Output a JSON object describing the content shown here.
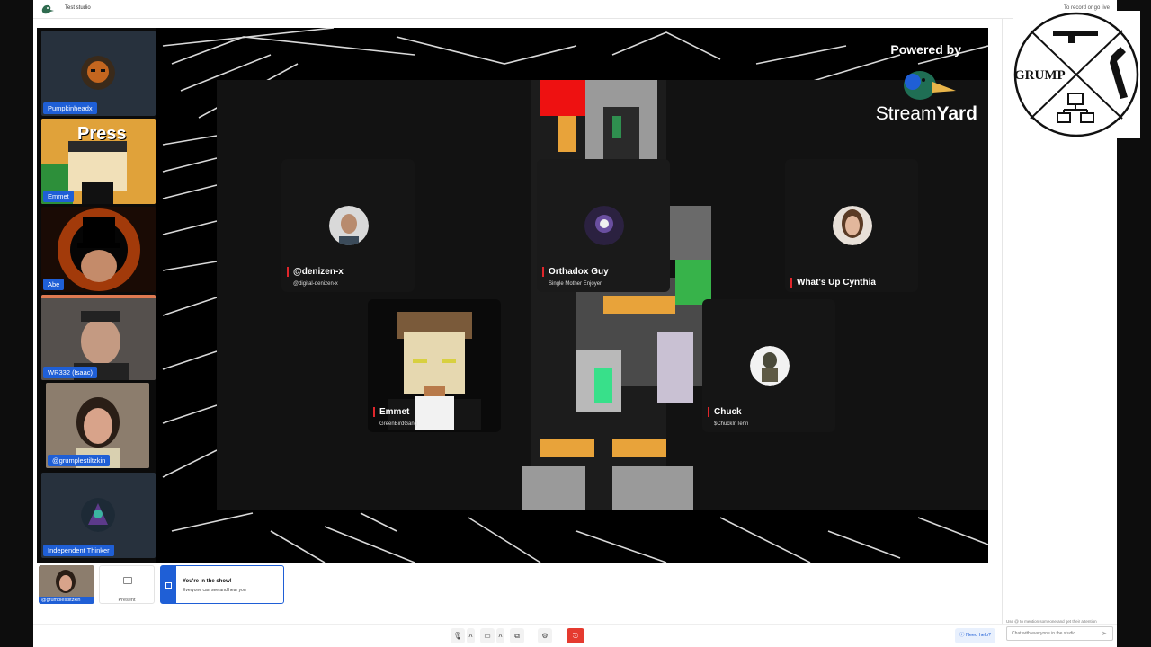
{
  "app": {
    "studio_title": "Test studio",
    "record_hint": "To record or go live"
  },
  "sidebar": {
    "participants": [
      {
        "name": "Pumpkinheadx"
      },
      {
        "name": "Emmet",
        "overlay": "Press"
      },
      {
        "name": "Abe"
      },
      {
        "name": "WR332 (Isaac)"
      },
      {
        "name": "@grumplestiltzkin"
      },
      {
        "name": "Independent Thinker"
      }
    ]
  },
  "stage": {
    "branding": {
      "powered_by": "Powered by",
      "stream": "Stream",
      "yard": "Yard"
    },
    "guests": [
      {
        "name": "@denizen-x",
        "subtitle": "@digital-denizen-x"
      },
      {
        "name": "Orthadox Guy",
        "subtitle": "Single Mother Enjoyer"
      },
      {
        "name": "What's Up Cynthia",
        "subtitle": ""
      },
      {
        "name": "Emmet",
        "subtitle": "GreenBirdGang"
      },
      {
        "name": "Chuck",
        "subtitle": "$ChuckInTenn"
      }
    ]
  },
  "under_stage": {
    "self_name": "@grumplestiltzkin",
    "present_label": "Present",
    "notice_title": "You're in the show!",
    "notice_body": "Everyone can see and hear you"
  },
  "controls": {
    "icons": [
      "microphone-icon",
      "chevron-up-icon",
      "camera-icon",
      "chevron-up-icon",
      "share-screen-icon",
      "settings-icon",
      "leave-icon"
    ],
    "help_label": "Need help?"
  },
  "chat": {
    "hint": "Use @ to mention someone and get their attention",
    "placeholder": "Chat with everyone in the studio"
  },
  "overlay_logo": {
    "text": "GRUMP"
  },
  "colors": {
    "accent": "#1f5fd6",
    "name_bar": "#e0262b",
    "leave": "#e53a2f"
  }
}
